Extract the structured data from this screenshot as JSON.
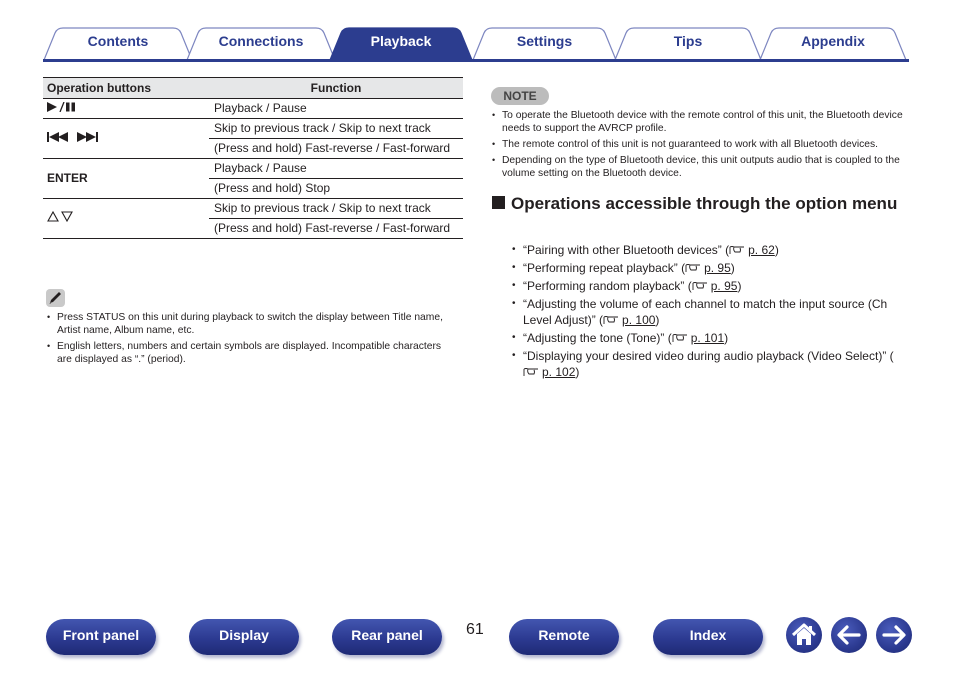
{
  "tabs": [
    {
      "label": "Contents",
      "active": false
    },
    {
      "label": "Connections",
      "active": false
    },
    {
      "label": "Playback",
      "active": true
    },
    {
      "label": "Settings",
      "active": false
    },
    {
      "label": "Tips",
      "active": false
    },
    {
      "label": "Appendix",
      "active": false
    }
  ],
  "table": {
    "headers": [
      "Operation buttons",
      "Function"
    ],
    "rows": [
      {
        "button": "►/❚❚",
        "functions": [
          "Playback / Pause"
        ]
      },
      {
        "button": "⏮ ⏭",
        "functions": [
          "Skip to previous track / Skip to next track",
          "(Press and hold) Fast-reverse / Fast-forward"
        ]
      },
      {
        "button": "ENTER",
        "functions": [
          "Playback / Pause",
          "(Press and hold) Stop"
        ]
      },
      {
        "button": "△ ▽",
        "functions": [
          "Skip to previous track / Skip to next track",
          "(Press and hold) Fast-reverse / Fast-forward"
        ]
      }
    ]
  },
  "tip_notes": [
    "Press STATUS on this unit during playback to switch the display between Title name, Artist name, Album name, etc.",
    "English letters, numbers and certain symbols are displayed. Incompatible characters are displayed as “.” (period)."
  ],
  "note": {
    "badge": "NOTE",
    "items": [
      "To operate the Bluetooth device with the remote control of this unit, the Bluetooth device needs to support the AVRCP profile.",
      "The remote control of this unit is not guaranteed to work with all Bluetooth devices.",
      "Depending on the type of Bluetooth device, this unit outputs audio that is coupled to the volume setting on the Bluetooth device."
    ]
  },
  "section": {
    "title": "Operations accessible through the option menu",
    "items": [
      {
        "text": "“Pairing with other Bluetooth devices” (",
        "ref": "p. 62"
      },
      {
        "text": "“Performing repeat playback” (",
        "ref": "p. 95"
      },
      {
        "text": "“Performing random playback” (",
        "ref": "p. 95"
      },
      {
        "text": "“Adjusting the volume of each channel to match the input source (Ch Level Adjust)” (",
        "ref": "p. 100"
      },
      {
        "text": "“Adjusting the tone (Tone)” (",
        "ref": "p. 101"
      },
      {
        "text": "“Displaying your desired video during audio playback (Video Select)” (",
        "ref": "p. 102"
      }
    ]
  },
  "footer": {
    "buttons": [
      "Front panel",
      "Display",
      "Rear panel",
      "Remote",
      "Index"
    ],
    "page_number": "61",
    "icons": [
      "home-icon",
      "back-arrow-icon",
      "forward-arrow-icon"
    ]
  },
  "colors": {
    "brand": "#2c3d8f",
    "header_bg": "#e6e7e8",
    "note_badge": "#bcbcbc"
  }
}
